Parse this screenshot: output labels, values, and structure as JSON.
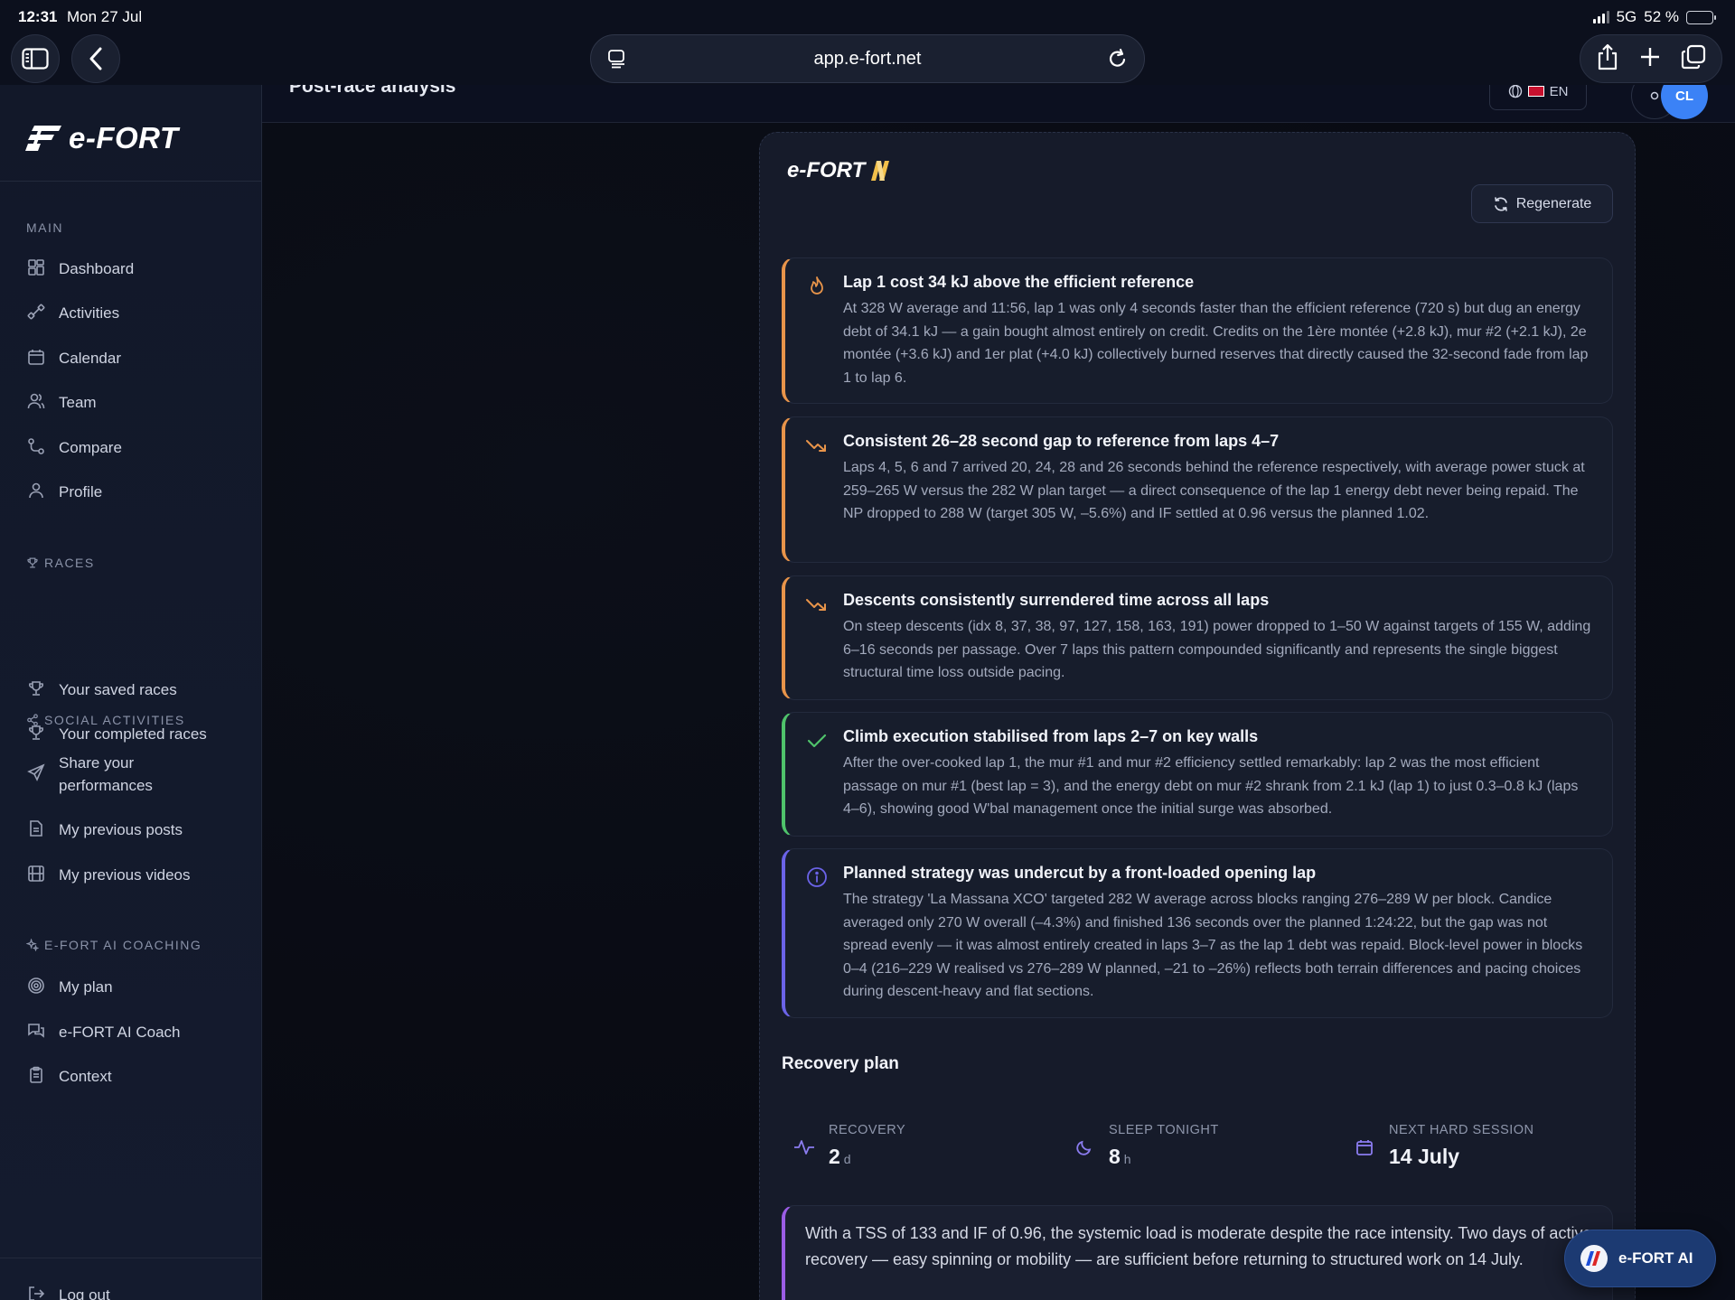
{
  "status_bar": {
    "time": "12:31",
    "date": "Mon 27 Jul",
    "network": "5G",
    "battery": "52 %",
    "battery_level": 0.52
  },
  "browser": {
    "url": "app.e-fort.net"
  },
  "header": {
    "page_title": "Post-race analysis",
    "language": "EN",
    "avatar_initials": "CL"
  },
  "sidebar": {
    "brand": "e-FORT",
    "sections": {
      "main": "MAIN",
      "races": "RACES",
      "social": "SOCIAL ACTIVITIES",
      "coaching": "E-FORT AI COACHING"
    },
    "items": {
      "dashboard": "Dashboard",
      "activities": "Activities",
      "calendar": "Calendar",
      "team": "Team",
      "compare": "Compare",
      "profile": "Profile",
      "saved_races": "Your saved races",
      "completed_races": "Your completed races",
      "share": "Share your performances",
      "posts": "My previous posts",
      "videos": "My previous videos",
      "plan": "My plan",
      "coach": "e-FORT AI Coach",
      "context": "Context"
    },
    "logout": "Log out"
  },
  "card": {
    "logo": "e-FORT",
    "regenerate_label": "Regenerate",
    "insights": [
      {
        "type": "warning",
        "icon": "flame-icon",
        "title": "Lap 1 cost 34 kJ above the efficient reference",
        "body": "At 328 W average and 11:56, lap 1 was only 4 seconds faster than the efficient reference (720 s) but dug an energy debt of 34.1 kJ — a gain bought almost entirely on credit. Credits on the 1ère montée (+2.8 kJ), mur #2 (+2.1 kJ), 2e montée (+3.6 kJ) and 1er plat (+4.0 kJ) collectively burned reserves that directly caused the 32-second fade from lap 1 to lap 6."
      },
      {
        "type": "warning",
        "icon": "trend-down-icon",
        "title": "Consistent 26–28 second gap to reference from laps 4–7",
        "body": "Laps 4, 5, 6 and 7 arrived 20, 24, 28 and 26 seconds behind the reference respectively, with average power stuck at 259–265 W versus the 282 W plan target — a direct consequence of the lap 1 energy debt never being repaid. The NP dropped to 288 W (target 305 W, –5.6%) and IF settled at 0.96 versus the planned 1.02."
      },
      {
        "type": "warning",
        "icon": "trend-down-icon",
        "title": "Descents consistently surrendered time across all laps",
        "body": "On steep descents (idx 8, 37, 38, 97, 127, 158, 163, 191) power dropped to 1–50 W against targets of 155 W, adding 6–16 seconds per passage. Over 7 laps this pattern compounded significantly and represents the single biggest structural time loss outside pacing."
      },
      {
        "type": "positive",
        "icon": "check-icon",
        "title": "Climb execution stabilised from laps 2–7 on key walls",
        "body": "After the over-cooked lap 1, the mur #1 and mur #2 efficiency settled remarkably: lap 2 was the most efficient passage on mur #1 (best lap = 3), and the energy debt on mur #2 shrank from 2.1 kJ (lap 1) to just 0.3–0.8 kJ (laps 4–6), showing good W'bal management once the initial surge was absorbed."
      },
      {
        "type": "info",
        "icon": "info-icon",
        "title": "Planned strategy was undercut by a front-loaded opening lap",
        "body": "The strategy 'La Massana XCO' targeted 282 W average across blocks ranging 276–289 W per block. Candice averaged only 270 W overall (–4.3%) and finished 136 seconds over the planned 1:24:22, but the gap was not spread evenly — it was almost entirely created in laps 3–7 as the lap 1 debt was repaid. Block-level power in blocks 0–4 (216–229 W realised vs 276–289 W planned, –21 to –26%) reflects both terrain differences and pacing choices during descent-heavy and flat sections."
      }
    ],
    "recovery": {
      "title": "Recovery plan",
      "stats": [
        {
          "label": "RECOVERY",
          "value": "2",
          "unit": "d"
        },
        {
          "label": "SLEEP TONIGHT",
          "value": "8",
          "unit": "h"
        },
        {
          "label": "NEXT HARD SESSION",
          "value": "14 July",
          "unit": ""
        }
      ],
      "note": "With a TSS of 133 and IF of 0.96, the systemic load is moderate despite the race intensity. Two days of active recovery — easy spinning or mobility — are sufficient before returning to structured work on 14 July."
    }
  },
  "ai_button": {
    "label": "e-FORT AI"
  },
  "colors": {
    "warning": "#e8944a",
    "positive": "#4fc36b",
    "info": "#6b63e8",
    "recovery_accent": "#9b5de5",
    "brand_blue": "#3b82f6"
  }
}
